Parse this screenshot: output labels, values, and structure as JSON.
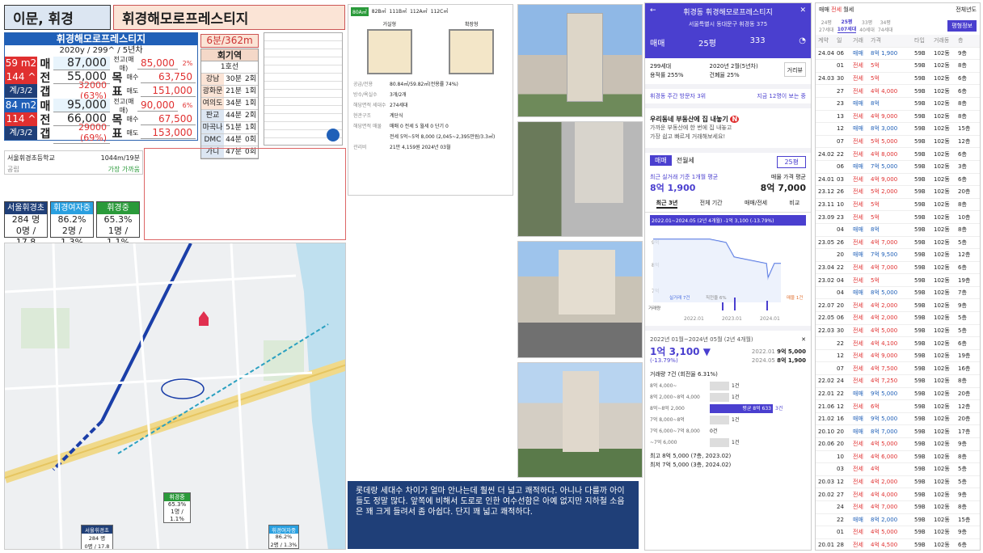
{
  "header": {
    "region": "이문, 휘경",
    "complex": "휘경해모로프레스티지"
  },
  "info": {
    "title": "휘경해모로프레스티지",
    "subtitle": "2020y / 299^ / 5년차",
    "rows": [
      {
        "a": "59 m2",
        "k": "매",
        "v": "87,000",
        "label": "전고(매매)",
        "v2": "85,000",
        "pct": "2%"
      },
      {
        "a": "144 ^",
        "k": "전",
        "v": "55,000",
        "label": "목",
        "sub": "매수",
        "v2": "63,750"
      },
      {
        "a": "계/3/2",
        "k": "갭",
        "v": "32000 (63%)",
        "label": "표",
        "sub": "매도",
        "v2": "151,000"
      },
      {
        "a": "84 m2",
        "k": "매",
        "v": "95,000",
        "label": "전고(매매)",
        "v2": "90,000",
        "pct": "6%"
      },
      {
        "a": "114 ^",
        "k": "전",
        "v": "66,000",
        "label": "목",
        "sub": "매수",
        "v2": "67,500"
      },
      {
        "a": "계/3/2",
        "k": "갭",
        "v": "29000 (69%)",
        "label": "표",
        "sub": "매도",
        "v2": "153,000"
      }
    ]
  },
  "commute": {
    "title": "6분/362m",
    "station": "회기역",
    "line": "1호선",
    "rows": [
      {
        "dest": "강남",
        "time": "30분",
        "tr": "2회"
      },
      {
        "dest": "광화문",
        "time": "21분",
        "tr": "1회"
      },
      {
        "dest": "여의도",
        "time": "34분",
        "tr": "1회"
      },
      {
        "dest": "판교",
        "time": "44분",
        "tr": "2회"
      },
      {
        "dest": "마곡나루",
        "time": "51분",
        "tr": "1회"
      },
      {
        "dest": "DMC",
        "time": "44분",
        "tr": "0회"
      },
      {
        "dest": "가디",
        "time": "47분",
        "tr": "0회"
      }
    ]
  },
  "school_box": {
    "name": "서울휘경초등학교",
    "dist": "1044m/19분",
    "type": "공립",
    "note": "가장 가까움"
  },
  "schools": [
    {
      "name": "서울휘경초",
      "v1": "284 명",
      "v2": "0명 / 17.8",
      "color": "#1f3f78"
    },
    {
      "name": "휘경여자중",
      "v1": "86.2%",
      "v2": "2명 / 1.3%",
      "color": "#2aa0e0"
    },
    {
      "name": "휘경중",
      "v1": "65.3%",
      "v2": "1명 / 1.1%",
      "color": "#2a9a3a"
    }
  ],
  "note_text": "롯데랑 세대수 차이가 얼마 안나는데 훨씬 더 넓고 쾌적하다. 아니나 다를까 아이들도 정말 많다. 앞쪽에 비해서 도로로 인한 여수선함은 아예 없지만 지하철 소음은 꽤 크게 들려서 좀 아쉽다. 단지 꽤 넓고 쾌적하다.",
  "floorplan": {
    "tabs": [
      "80A㎡",
      "82B㎡",
      "111B㎡",
      "112A㎡",
      "112C㎡"
    ],
    "plans": [
      "거실형",
      "확장형"
    ],
    "rows": [
      {
        "k": "공급/전용",
        "v": "80.84㎡/59.82㎡(전용률 74%)"
      },
      {
        "k": "방수/욕실수",
        "v": "3개/2개"
      },
      {
        "k": "해당면적 세대수",
        "v": "274세대"
      },
      {
        "k": "현관구조",
        "v": "계단식"
      },
      {
        "k": "해당면적 매물",
        "v": "매매 0 전세 5 월세 0 단기 0"
      },
      {
        "k": "",
        "v": "전세 5억~5억 8,000 (2,045~2,395만원/3.3㎡)"
      },
      {
        "k": "관리비",
        "v": "21만 4,159원  2024년 03월"
      }
    ]
  },
  "map_labels": {
    "school1": "휘경중",
    "school1_v1": "65.3%",
    "school1_v2": "1명 / 1.1%",
    "school2": "서울휘경초",
    "school2_v1": "284 명",
    "school2_v2": "0명 / 17.8",
    "school3": "휘경여자중",
    "school3_v1": "86.2%",
    "school3_v2": "2명 / 1.3%"
  },
  "app": {
    "title": "휘경동 휘경해모로프레스티지",
    "address": "서울특별시 동대문구 휘경동 375",
    "tab1": "매매",
    "size": "25평",
    "comments": "333",
    "households": "299세대",
    "built": "2020년 2월(5년차)",
    "far": "용적률 255%",
    "bcr": "건폐율 25%",
    "dist_btn": "거리뷰",
    "visitors": "휘경동 주간 방문자 3위",
    "visitors_link": "지금 12명이 보는 중",
    "banner_title": "우리동네 부동산에 집 내놓기",
    "banner_badge": "N",
    "banner_sub1": "가까운 부동산에 한 번에 집 내놓고",
    "banner_sub2": "가장 쉽고 빠르게 거래해보세요!",
    "tab_sale": "매매",
    "tab_jeonse": "전월세",
    "size2": "25평",
    "recent_label": "최근 실거래 기준 1개월 평균",
    "recent_value": "8억 1,900",
    "list_label": "매물 가격 평균",
    "list_value": "8억 7,000",
    "period_tabs": [
      "최근 3년",
      "전체 기간",
      "매매/전세",
      "비교"
    ],
    "chart_range": "2022.01~2024.05 (2년 4개월)   -1억 3,100 (-13.79%)",
    "chart_x": [
      "2022.01",
      "2023.01",
      "2024.01"
    ],
    "chart_y": [
      "9억",
      "8억",
      "7억"
    ],
    "legend_a": "실거래 7건",
    "legend_b": "직전율 6%",
    "legend_c": "매물 1건",
    "vol_label": "거래량",
    "period_text": "2022년 01월~2024년 05월 (2년 4개월)",
    "drop": "1억 3,100 ▼",
    "drop_pct": "(-13.79%)",
    "p1_date": "2022.01",
    "p1_val": "9억 5,000",
    "p2_date": "2024.05",
    "p2_val": "8억 1,900",
    "count": "거래량 7건 (회전율 6.31%)",
    "dist": [
      {
        "r": "8억 4,000~",
        "c": "1건"
      },
      {
        "r": "8억 2,000~8억 4,000",
        "c": "1건"
      },
      {
        "r": "8억~8억 2,000",
        "c": "3건",
        "hl": "평균 8억 633"
      },
      {
        "r": "7억 8,000~8억",
        "c": "1건"
      },
      {
        "r": "7억 6,000~7억 8,000",
        "c": "0건"
      },
      {
        "r": "~7억 6,000",
        "c": "1건"
      }
    ],
    "max": "최고 8억 5,000 (7층, 2023.02)",
    "min": "최저 7억 5,000 (3층, 2024.02)"
  },
  "records": {
    "tabs": [
      "매매",
      "전세",
      "월세"
    ],
    "filter": "전체년도",
    "sizes": [
      {
        "t": "24평",
        "s": "27세대"
      },
      {
        "t": "25평",
        "s": "107세대"
      },
      {
        "t": "33평",
        "s": "40세대"
      },
      {
        "t": "34평",
        "s": "74세대"
      }
    ],
    "btn": "평형정보",
    "headers": [
      "계약",
      "일",
      "거래",
      "가격",
      "타입",
      "거래동",
      "층"
    ],
    "rows": [
      [
        "24.04",
        "06",
        "매매",
        "8억 1,900",
        "59B",
        "102동",
        "9층"
      ],
      [
        "",
        "01",
        "전세",
        "5억",
        "59B",
        "102동",
        "8층"
      ],
      [
        "24.03",
        "30",
        "전세",
        "5억",
        "59B",
        "102동",
        "6층"
      ],
      [
        "",
        "27",
        "전세",
        "4억 4,000",
        "59B",
        "102동",
        "6층"
      ],
      [
        "",
        "23",
        "매매",
        "8억",
        "59B",
        "102동",
        "8층"
      ],
      [
        "",
        "13",
        "전세",
        "4억 9,000",
        "59B",
        "102동",
        "8층"
      ],
      [
        "",
        "12",
        "매매",
        "8억 3,000",
        "59B",
        "102동",
        "15층"
      ],
      [
        "",
        "07",
        "전세",
        "5억 5,000",
        "59B",
        "102동",
        "12층"
      ],
      [
        "24.02",
        "22",
        "전세",
        "4억 8,000",
        "59B",
        "102동",
        "6층"
      ],
      [
        "",
        "06",
        "매매",
        "7억 5,000",
        "59B",
        "102동",
        "3층"
      ],
      [
        "24.01",
        "03",
        "전세",
        "4억 9,000",
        "59B",
        "102동",
        "6층"
      ],
      [
        "23.12",
        "26",
        "전세",
        "5억 2,000",
        "59B",
        "102동",
        "20층"
      ],
      [
        "23.11",
        "10",
        "전세",
        "5억",
        "59B",
        "102동",
        "8층"
      ],
      [
        "23.09",
        "23",
        "전세",
        "5억",
        "59B",
        "102동",
        "10층"
      ],
      [
        "",
        "04",
        "매매",
        "8억",
        "59B",
        "102동",
        "8층"
      ],
      [
        "23.05",
        "26",
        "전세",
        "4억 7,000",
        "59B",
        "102동",
        "5층"
      ],
      [
        "",
        "20",
        "매매",
        "7억 9,500",
        "59B",
        "102동",
        "12층"
      ],
      [
        "23.04",
        "22",
        "전세",
        "4억 7,000",
        "59B",
        "102동",
        "6층"
      ],
      [
        "23.02",
        "04",
        "전세",
        "5억",
        "59B",
        "102동",
        "19층"
      ],
      [
        "",
        "04",
        "매매",
        "8억 5,000",
        "59B",
        "102동",
        "7층"
      ],
      [
        "22.07",
        "20",
        "전세",
        "4억 2,000",
        "59B",
        "102동",
        "9층"
      ],
      [
        "22.05",
        "06",
        "전세",
        "4억 2,000",
        "59B",
        "102동",
        "5층"
      ],
      [
        "22.03",
        "30",
        "전세",
        "4억 5,000",
        "59B",
        "102동",
        "5층"
      ],
      [
        "",
        "22",
        "전세",
        "4억 4,100",
        "59B",
        "102동",
        "6층"
      ],
      [
        "",
        "12",
        "전세",
        "4억 9,000",
        "59B",
        "102동",
        "19층"
      ],
      [
        "",
        "07",
        "전세",
        "4억 7,500",
        "59B",
        "102동",
        "16층"
      ],
      [
        "22.02",
        "24",
        "전세",
        "4억 7,250",
        "59B",
        "102동",
        "8층"
      ],
      [
        "22.01",
        "22",
        "매매",
        "9억 5,000",
        "59B",
        "102동",
        "20층"
      ],
      [
        "21.06",
        "12",
        "전세",
        "6억",
        "59B",
        "102동",
        "12층"
      ],
      [
        "21.02",
        "16",
        "매매",
        "9억 5,000",
        "59B",
        "102동",
        "20층"
      ],
      [
        "20.10",
        "20",
        "매매",
        "8억 7,000",
        "59B",
        "102동",
        "17층"
      ],
      [
        "20.06",
        "20",
        "전세",
        "4억 5,000",
        "59B",
        "102동",
        "9층"
      ],
      [
        "",
        "10",
        "전세",
        "4억 6,000",
        "59B",
        "102동",
        "8층"
      ],
      [
        "",
        "03",
        "전세",
        "4억",
        "59B",
        "102동",
        "5층"
      ],
      [
        "20.03",
        "12",
        "전세",
        "4억 2,000",
        "59B",
        "102동",
        "5층"
      ],
      [
        "20.02",
        "27",
        "전세",
        "4억 4,000",
        "59B",
        "102동",
        "9층"
      ],
      [
        "",
        "24",
        "전세",
        "4억 7,000",
        "59B",
        "102동",
        "8층"
      ],
      [
        "",
        "22",
        "매매",
        "8억 2,000",
        "59B",
        "102동",
        "15층"
      ],
      [
        "",
        "01",
        "전세",
        "4억 5,000",
        "59B",
        "102동",
        "9층"
      ],
      [
        "20.01",
        "28",
        "전세",
        "4억 4,500",
        "59B",
        "102동",
        "6층"
      ]
    ]
  },
  "colors": {
    "blue": "#2060b8",
    "red": "#e03030",
    "purple": "#4a3fcf"
  }
}
